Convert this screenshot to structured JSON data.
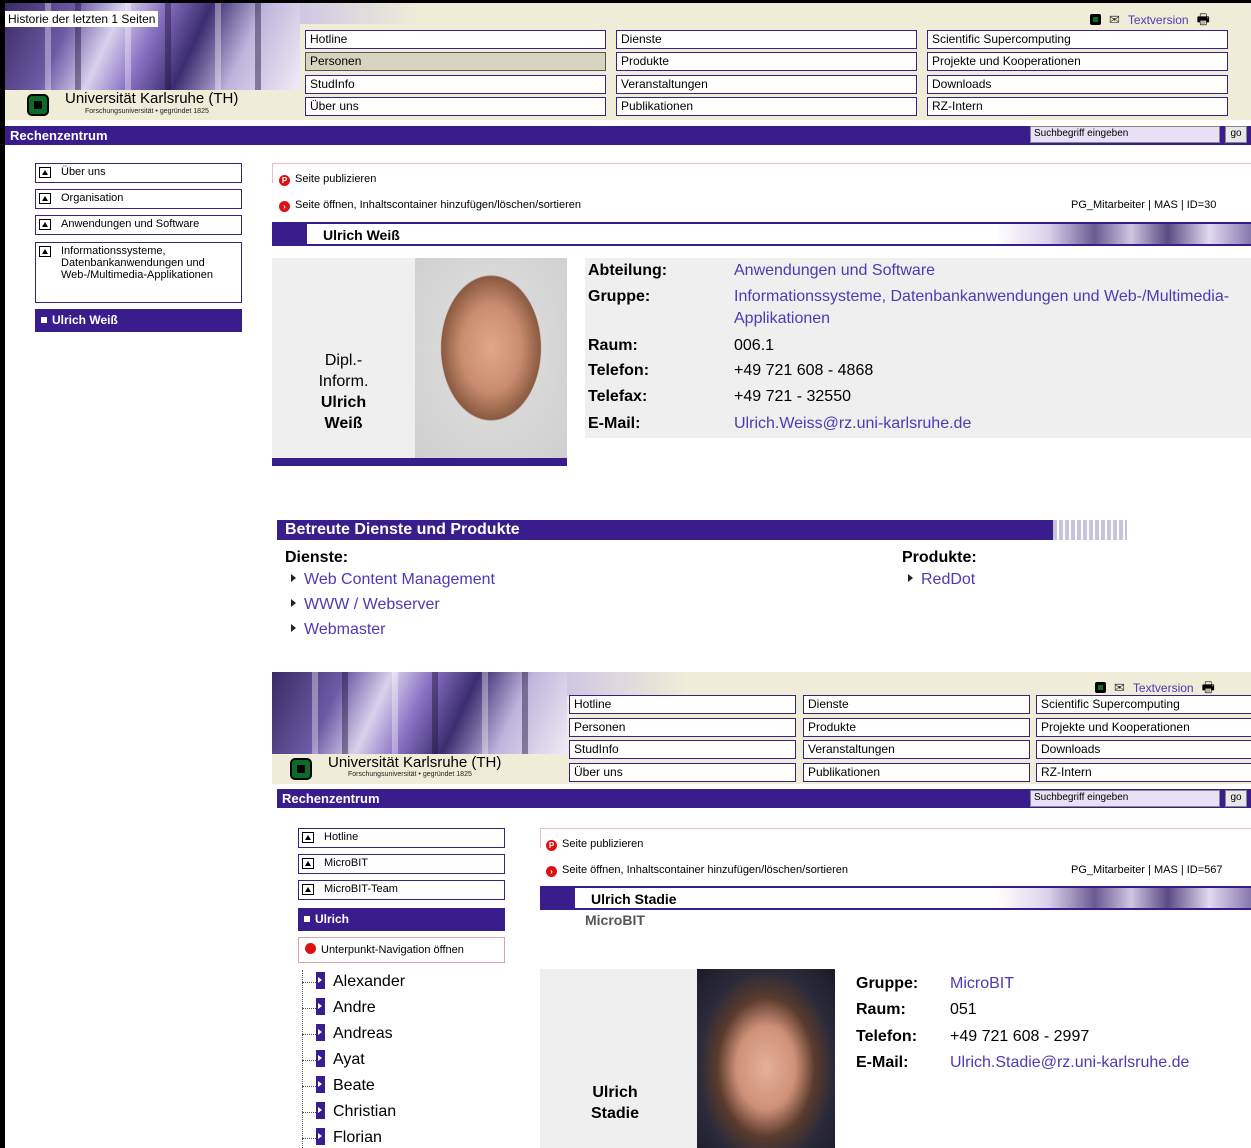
{
  "top": {
    "history": "Historie der letzten 1 Seiten",
    "university": "Universität Karlsruhe (TH)",
    "university_sub": "Forschungsuniversität • gegründet 1825",
    "textversion": "Textversion",
    "nav": [
      [
        "Hotline",
        "Dienste",
        "Scientific Supercomputing"
      ],
      [
        "Personen",
        "Produkte",
        "Projekte und Kooperationen"
      ],
      [
        "StudInfo",
        "Veranstaltungen",
        "Downloads"
      ],
      [
        "Über uns",
        "Publikationen",
        "RZ-Intern"
      ]
    ],
    "rz": "Rechenzentrum",
    "search_placeholder": "Suchbegriff eingeben",
    "go": "go"
  },
  "left": {
    "items": [
      "Über uns",
      "Organisation",
      "Anwendungen und Software",
      "Informationssysteme, Datenbankanwendungen und Web-/Multimedia-Applikationen"
    ],
    "selected": "Ulrich Weiß"
  },
  "content": {
    "publish": "Seite publizieren",
    "open": "Seite öffnen, Inhaltscontainer hinzufügen/löschen/sortieren",
    "pgid": "PG_Mitarbeiter | MAS | ID=30",
    "name": "Ulrich Weiß",
    "caption1": "Dipl.-",
    "caption2": "Inform.",
    "caption3": "Ulrich",
    "caption4": "Weiß",
    "labels": [
      "Abteilung:",
      "Gruppe:",
      "Raum:",
      "Telefon:",
      "Telefax:",
      "E-Mail:"
    ],
    "abteilung": "Anwendungen und Software",
    "gruppe1": "Informationssysteme, Datenbankanwendungen und Web-/Multimedia-",
    "gruppe2": "Applikationen",
    "raum": "006.1",
    "telefon": "+49 721 608 - 4868",
    "telefax": "+49 721 - 32550",
    "email": "Ulrich.Weiss@rz.uni-karlsruhe.de"
  },
  "services": {
    "title": "Betreute Dienste und Produkte",
    "dienste_label": "Dienste:",
    "produkte_label": "Produkte:",
    "dienste": [
      "Web Content Management",
      "WWW / Webserver",
      "Webmaster"
    ],
    "produkte": [
      "RedDot"
    ]
  },
  "embedded": {
    "textversion": "Textversion",
    "university": "Universität Karlsruhe (TH)",
    "university_sub": "Forschungsuniversität • gegründet 1825",
    "nav": [
      [
        "Hotline",
        "Dienste",
        "Scientific Supercomputing"
      ],
      [
        "Personen",
        "Produkte",
        "Projekte und Kooperationen"
      ],
      [
        "StudInfo",
        "Veranstaltungen",
        "Downloads"
      ],
      [
        "Über uns",
        "Publikationen",
        "RZ-Intern"
      ]
    ],
    "rz": "Rechenzentrum",
    "search_placeholder": "Suchbegriff eingeben",
    "go": "go",
    "left_items": [
      "Hotline",
      "MicroBIT",
      "MicroBIT-Team"
    ],
    "left_selected": "Ulrich",
    "unterpunkt": "Unterpunkt-Navigation öffnen",
    "tree": [
      "Alexander",
      "Andre",
      "Andreas",
      "Ayat",
      "Beate",
      "Christian",
      "Florian"
    ],
    "publish": "Seite publizieren",
    "open": "Seite öffnen, Inhaltscontainer hinzufügen/löschen/sortieren",
    "pgid": "PG_Mitarbeiter | MAS | ID=567",
    "name": "Ulrich Stadie",
    "subname": "MicroBIT",
    "caption1": "Ulrich",
    "caption2": "Stadie",
    "labels": [
      "Gruppe:",
      "Raum:",
      "Telefon:",
      "E-Mail:"
    ],
    "gruppe": "MicroBIT",
    "raum": "051",
    "telefon": "+49 721 608 - 2997",
    "email": "Ulrich.Stadie@rz.uni-karlsruhe.de"
  }
}
